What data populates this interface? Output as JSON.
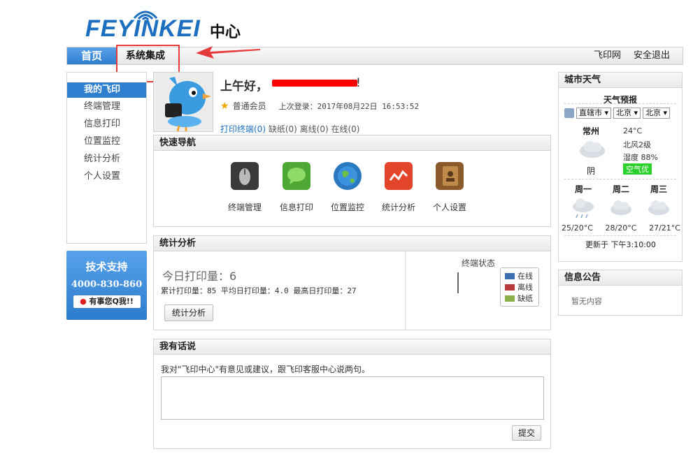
{
  "logo": {
    "brand": "FEYINKEI",
    "sub": "中心"
  },
  "nav": {
    "home": "首页",
    "system": "系统集成",
    "right": [
      "飞印网",
      "安全退出"
    ]
  },
  "sidebar": {
    "active": "我的飞印",
    "items": [
      "终端管理",
      "信息打印",
      "位置监控",
      "统计分析",
      "个人设置"
    ]
  },
  "support": {
    "title": "技术支持",
    "phone": "4000-830-860",
    "qq": "有事您Q我!!"
  },
  "profile": {
    "greeting": "上午好，",
    "greeting_end": "!",
    "member": "普通会员",
    "last_login": "上次登录：2017年08月22日 16:53:52",
    "stats": {
      "print_terminal": "打印终端(0)",
      "no_paper": "缺纸(0)",
      "offline": "离线(0)",
      "online": "在线(0)"
    }
  },
  "quick": {
    "title": "快速导航",
    "items": [
      {
        "label": "终端管理",
        "color": "#3a3a3a"
      },
      {
        "label": "信息打印",
        "color": "#4fa833"
      },
      {
        "label": "位置监控",
        "color": "#2a78c0"
      },
      {
        "label": "统计分析",
        "color": "#e2452a"
      },
      {
        "label": "个人设置",
        "color": "#8b5a2b"
      }
    ]
  },
  "stat": {
    "title": "统计分析",
    "today": "今日打印量：6",
    "summary": "累计打印量：85   平均日打印量：4.0   最高日打印量：27",
    "button": "统计分析",
    "terminal_title": "终端状态",
    "legend": [
      {
        "label": "在线",
        "color": "#3b6fb0"
      },
      {
        "label": "离线",
        "color": "#b83b3b"
      },
      {
        "label": "缺纸",
        "color": "#8bb04a"
      }
    ]
  },
  "talk": {
    "title": "我有话说",
    "prompt": "我对\"飞印中心\"有意见或建议，跟飞印客服中心说两句。",
    "submit": "提交"
  },
  "weather": {
    "title": "城市天气",
    "forecast_title": "天气预报",
    "selects": [
      "直辖市",
      "北京",
      "北京"
    ],
    "city": "常州",
    "temp": "24°C",
    "wind": "北风2级",
    "humidity": "湿度 88%",
    "air": "空气优",
    "desc": "阴",
    "days": [
      "周一",
      "周二",
      "周三"
    ],
    "day_temps": [
      "25/20°C",
      "28/20°C",
      "27/21°C"
    ],
    "updated": "更新于 下午3:10:00"
  },
  "notice": {
    "title": "信息公告",
    "body": "暂无内容"
  }
}
